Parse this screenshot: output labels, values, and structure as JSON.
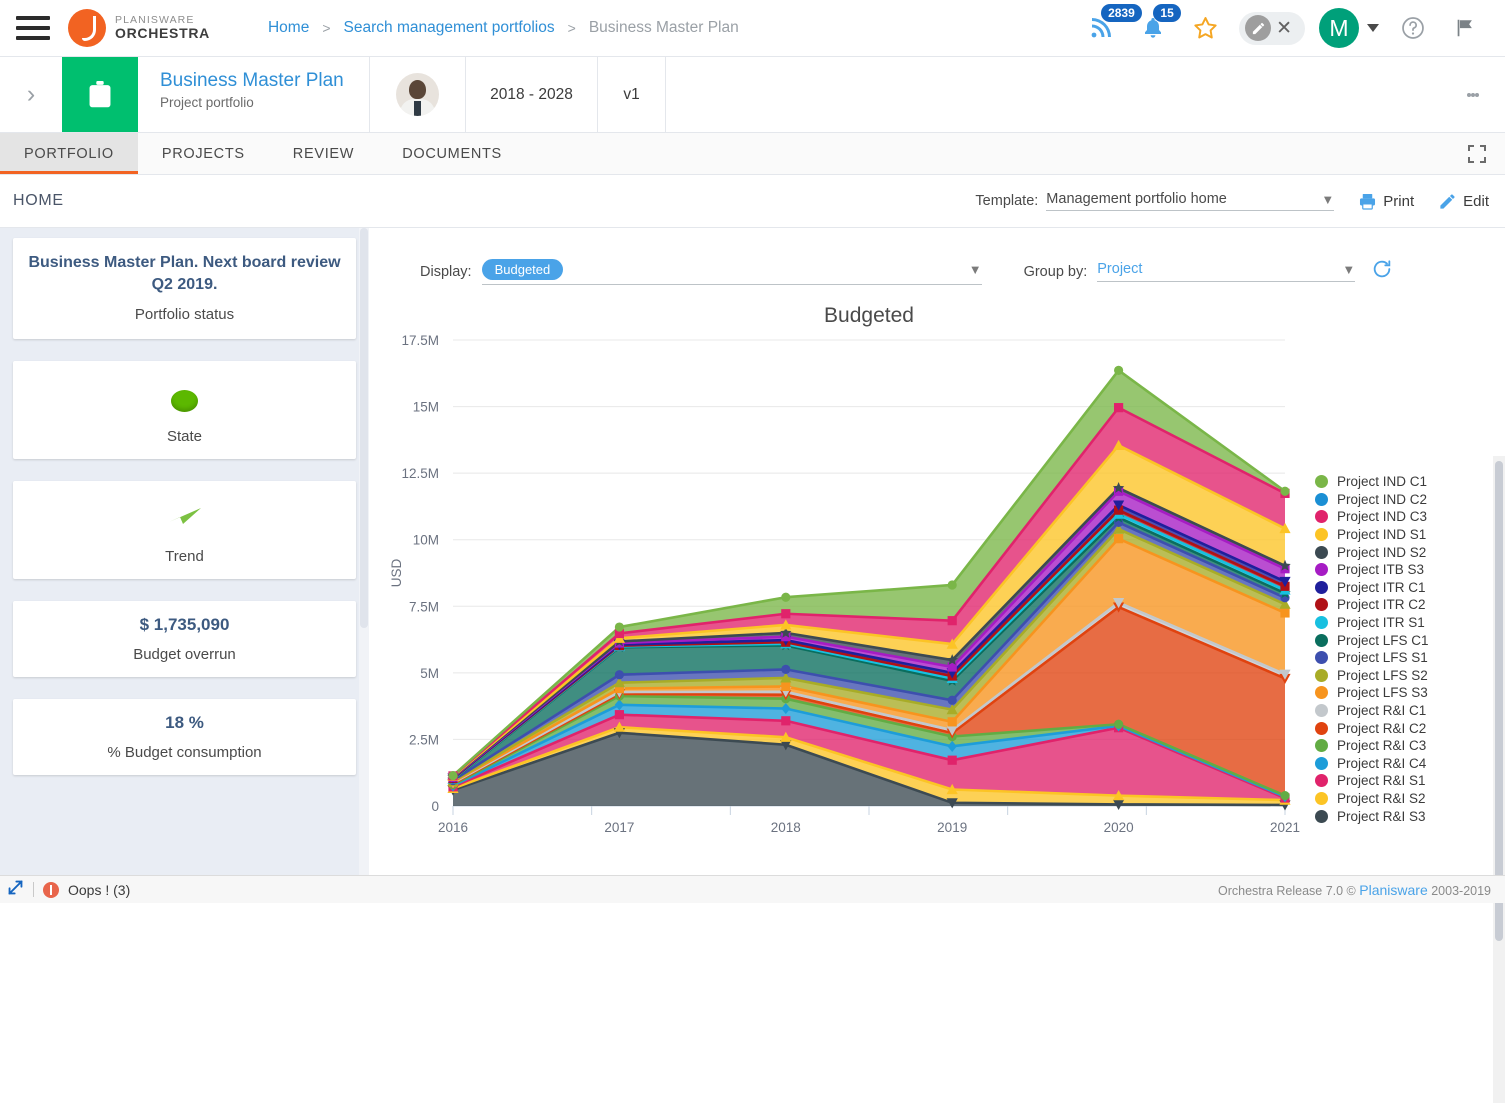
{
  "topbar": {
    "logo_line1": "PLANISWARE",
    "logo_line2": "ORCHESTRA",
    "breadcrumb": [
      {
        "label": "Home",
        "current": false
      },
      {
        "label": "Search management portfolios",
        "current": false
      },
      {
        "label": "Business Master Plan",
        "current": true
      }
    ],
    "separator": ">",
    "rss_badge": "2839",
    "bell_badge": "15",
    "avatar_initial": "M"
  },
  "project_header": {
    "title": "Business Master Plan",
    "subtitle": "Project portfolio",
    "date_range": "2018 - 2028",
    "version": "v1"
  },
  "tabs": [
    {
      "label": "PORTFOLIO",
      "active": true
    },
    {
      "label": "PROJECTS",
      "active": false
    },
    {
      "label": "REVIEW",
      "active": false
    },
    {
      "label": "DOCUMENTS",
      "active": false
    }
  ],
  "home_row": {
    "home_label": "HOME",
    "template_label": "Template:",
    "template_value": "Management portfolio home",
    "print_label": "Print",
    "edit_label": "Edit"
  },
  "sidebar": {
    "cards": [
      {
        "title": "Business Master Plan. Next board review Q2 2019.",
        "sub": "Portfolio status",
        "kind": "status"
      },
      {
        "title": "",
        "sub": "State",
        "kind": "dot"
      },
      {
        "title": "",
        "sub": "Trend",
        "kind": "arrow"
      },
      {
        "title": "$ 1,735,090",
        "sub": "Budget overrun",
        "kind": "value"
      },
      {
        "title": "18 %",
        "sub": "% Budget consumption",
        "kind": "value"
      }
    ]
  },
  "chart_controls": {
    "display_label": "Display:",
    "display_value": "Budgeted",
    "groupby_label": "Group by:",
    "groupby_value": "Project",
    "refresh_icon": "refresh-icon"
  },
  "chart_data": {
    "type": "area",
    "title": "Budgeted",
    "subtitle": "",
    "xlabel": "",
    "ylabel": "USD",
    "categories": [
      "2016",
      "2017",
      "2018",
      "2019",
      "2020",
      "2021"
    ],
    "x": [
      2016,
      2017,
      2018,
      2019,
      2020,
      2021
    ],
    "ylim": [
      0,
      17500000
    ],
    "ytick_labels": [
      "0",
      "2.5M",
      "5M",
      "7.5M",
      "10M",
      "12.5M",
      "15M",
      "17.5M"
    ],
    "ytick_values": [
      0,
      2500000,
      5000000,
      7500000,
      10000000,
      12500000,
      15000000,
      17500000
    ],
    "grid": true,
    "legend_position": "right",
    "stacked": true,
    "series": [
      {
        "name": "Project R&I S3",
        "color": "#3c4a52",
        "marker": "triangle-down",
        "values": [
          600000,
          2750000,
          2300000,
          120000,
          60000,
          40000
        ]
      },
      {
        "name": "Project R&I S2",
        "color": "#fcc425",
        "marker": "triangle-up",
        "values": [
          60000,
          210000,
          280000,
          500000,
          330000,
          180000
        ]
      },
      {
        "name": "Project R&I S1",
        "color": "#e0236b",
        "marker": "square",
        "values": [
          60000,
          470000,
          620000,
          1100000,
          2550000,
          80000
        ]
      },
      {
        "name": "Project R&I C4",
        "color": "#1d9dd9",
        "marker": "diamond",
        "values": [
          40000,
          370000,
          460000,
          520000,
          70000,
          50000
        ]
      },
      {
        "name": "Project R&I C3",
        "color": "#62ac44",
        "marker": "circle",
        "values": [
          40000,
          330000,
          370000,
          370000,
          60000,
          40000
        ]
      },
      {
        "name": "Project R&I C2",
        "color": "#e0430f",
        "marker": "triangle-down",
        "values": [
          40000,
          80000,
          150000,
          130000,
          4400000,
          4400000
        ]
      },
      {
        "name": "Project R&I C1",
        "color": "#c3c8cc",
        "marker": "triangle-down",
        "values": [
          30000,
          70000,
          110000,
          110000,
          170000,
          160000
        ]
      },
      {
        "name": "Project LFS S3",
        "color": "#f7941e",
        "marker": "square",
        "values": [
          30000,
          130000,
          200000,
          310000,
          2400000,
          2300000
        ]
      },
      {
        "name": "Project LFS S2",
        "color": "#a8ac27",
        "marker": "triangle-up",
        "values": [
          30000,
          220000,
          320000,
          460000,
          360000,
          330000
        ]
      },
      {
        "name": "Project LFS S1",
        "color": "#3d4fae",
        "marker": "circle",
        "values": [
          30000,
          300000,
          320000,
          350000,
          250000,
          240000
        ]
      },
      {
        "name": "Project LFS C1",
        "color": "#0a6e5e",
        "marker": "star",
        "values": [
          30000,
          1030000,
          900000,
          730000,
          180000,
          170000
        ]
      },
      {
        "name": "Project ITR S1",
        "color": "#18c0e0",
        "marker": "triangle-up",
        "values": [
          20000,
          30000,
          60000,
          90000,
          130000,
          120000
        ]
      },
      {
        "name": "Project ITR C2",
        "color": "#b01116",
        "marker": "square",
        "values": [
          20000,
          30000,
          60000,
          90000,
          150000,
          140000
        ]
      },
      {
        "name": "Project ITR C1",
        "color": "#1f1f9c",
        "marker": "triangle-down",
        "values": [
          20000,
          40000,
          80000,
          120000,
          190000,
          180000
        ]
      },
      {
        "name": "Project ITB S3",
        "color": "#a61cc4",
        "marker": "square",
        "values": [
          20000,
          60000,
          130000,
          220000,
          520000,
          480000
        ]
      },
      {
        "name": "Project IND S2",
        "color": "#3c4a52",
        "marker": "star",
        "values": [
          20000,
          60000,
          140000,
          260000,
          120000,
          110000
        ]
      },
      {
        "name": "Project IND S1",
        "color": "#fcc425",
        "marker": "triangle-up",
        "values": [
          20000,
          120000,
          300000,
          600000,
          1600000,
          1400000
        ]
      },
      {
        "name": "Project IND C3",
        "color": "#e0236b",
        "marker": "square",
        "values": [
          20000,
          180000,
          420000,
          880000,
          1420000,
          1320000
        ]
      },
      {
        "name": "Project IND C1",
        "color": "#7ab648",
        "marker": "circle",
        "values": [
          10000,
          240000,
          620000,
          1340000,
          1400000,
          80000
        ]
      }
    ],
    "legend_entries": [
      {
        "label": "Project IND C1",
        "color": "#7ab648"
      },
      {
        "label": "Project IND C2",
        "color": "#1b8fd4"
      },
      {
        "label": "Project IND C3",
        "color": "#e0236b"
      },
      {
        "label": "Project IND S1",
        "color": "#fcc425"
      },
      {
        "label": "Project IND S2",
        "color": "#3c4a52"
      },
      {
        "label": "Project ITB S3",
        "color": "#a61cc4"
      },
      {
        "label": "Project ITR C1",
        "color": "#1f1f9c"
      },
      {
        "label": "Project ITR C2",
        "color": "#b01116"
      },
      {
        "label": "Project ITR S1",
        "color": "#18c0e0"
      },
      {
        "label": "Project LFS C1",
        "color": "#0a6e5e"
      },
      {
        "label": "Project LFS S1",
        "color": "#3d4fae"
      },
      {
        "label": "Project LFS S2",
        "color": "#a8ac27"
      },
      {
        "label": "Project LFS S3",
        "color": "#f7941e"
      },
      {
        "label": "Project R&I C1",
        "color": "#c3c8cc"
      },
      {
        "label": "Project R&I C2",
        "color": "#e0430f"
      },
      {
        "label": "Project R&I C3",
        "color": "#62ac44"
      },
      {
        "label": "Project R&I C4",
        "color": "#1d9dd9"
      },
      {
        "label": "Project R&I S1",
        "color": "#e0236b"
      },
      {
        "label": "Project R&I S2",
        "color": "#fcc425"
      },
      {
        "label": "Project R&I S3",
        "color": "#3c4a52"
      }
    ]
  },
  "footer": {
    "error_text": "Oops ! (3)",
    "release_prefix": "Orchestra Release 7.0 ©",
    "brand": "Planisware",
    "years": "2003-2019"
  },
  "colors": {
    "accent_orange": "#f26322",
    "link_blue": "#2f8fd6",
    "green": "#00bf6f",
    "badge_blue": "#1565c0"
  }
}
